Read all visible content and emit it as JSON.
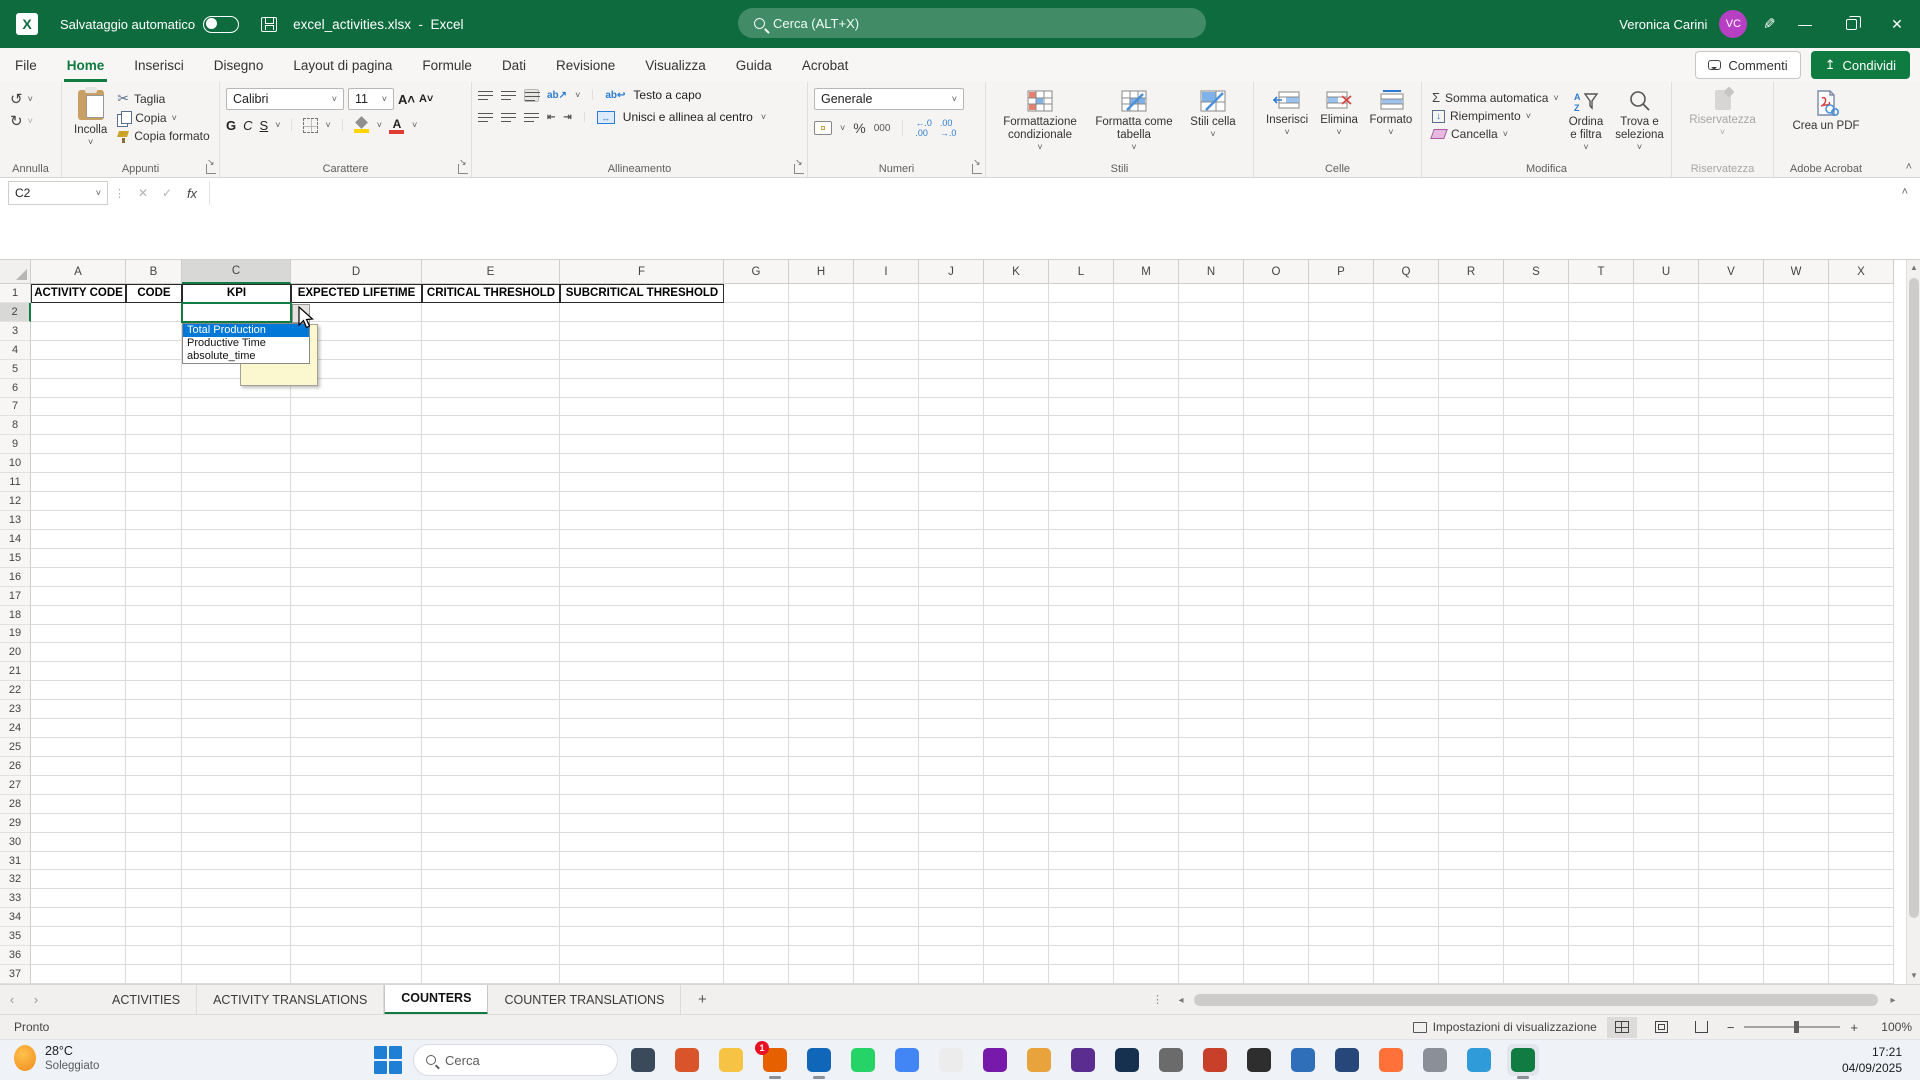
{
  "titlebar": {
    "autosave_label": "Salvataggio automatico",
    "autosave_state": "off",
    "filename": "excel_activities.xlsx",
    "separator": "-",
    "app_name": "Excel",
    "search_placeholder": "Cerca (ALT+X)",
    "user_name": "Veronica Carini",
    "user_initials": "VC"
  },
  "menubar": {
    "tabs": [
      "File",
      "Home",
      "Inserisci",
      "Disegno",
      "Layout di pagina",
      "Formule",
      "Dati",
      "Revisione",
      "Visualizza",
      "Guida",
      "Acrobat"
    ],
    "active_tab": "Home",
    "comments": "Commenti",
    "share": "Condividi"
  },
  "ribbon": {
    "annulla": {
      "label": "Annulla"
    },
    "appunti": {
      "label": "Appunti",
      "paste": "Incolla",
      "cut": "Taglia",
      "copy": "Copia",
      "format_painter": "Copia formato"
    },
    "carattere": {
      "label": "Carattere",
      "font_name": "Calibri",
      "font_size": "11",
      "bold": "G",
      "italic": "C",
      "underline": "S"
    },
    "allineamento": {
      "label": "Allineamento",
      "wrap": "Testo a capo",
      "merge": "Unisci e allinea al centro"
    },
    "numeri": {
      "label": "Numeri",
      "number_format": "Generale",
      "thousands": "000",
      "percent": "%"
    },
    "stili": {
      "label": "Stili",
      "conditional": "Formattazione condizionale",
      "format_table": "Formatta come tabella",
      "cell_styles": "Stili cella"
    },
    "celle": {
      "label": "Celle",
      "insert": "Inserisci",
      "delete": "Elimina",
      "format": "Formato"
    },
    "modifica": {
      "label": "Modifica",
      "autosum": "Somma automatica",
      "fill": "Riempimento",
      "clear": "Cancella",
      "sort": "Ordina e filtra",
      "find": "Trova e seleziona"
    },
    "riservatezza": {
      "label": "Riservatezza",
      "button": "Riservatezza"
    },
    "acrobat": {
      "label": "Adobe Acrobat",
      "create_pdf": "Crea un PDF"
    }
  },
  "formula_bar": {
    "name_box": "C2",
    "formula": ""
  },
  "grid": {
    "columns": [
      "A",
      "B",
      "C",
      "D",
      "E",
      "F",
      "G",
      "H",
      "I",
      "J",
      "K",
      "L",
      "M",
      "N",
      "O",
      "P",
      "Q",
      "R",
      "S",
      "T",
      "U",
      "V",
      "W",
      "X"
    ],
    "row_count": 37,
    "selected_cell": "C2",
    "selected_column": "C",
    "selected_row": 2,
    "table_headers": {
      "A": "ACTIVITY CODE",
      "B": "CODE",
      "C": "KPI",
      "D": "EXPECTED LIFETIME",
      "E": "CRITICAL THRESHOLD",
      "F": "SUBCRITICAL THRESHOLD"
    }
  },
  "dropdown": {
    "options": [
      "Total Production",
      "Productive Time",
      "absolute_time"
    ],
    "selected": "Total Production"
  },
  "sheet_tabs": {
    "tabs": [
      "ACTIVITIES",
      "ACTIVITY TRANSLATIONS",
      "COUNTERS",
      "COUNTER TRANSLATIONS"
    ],
    "active": "COUNTERS",
    "add": "+"
  },
  "status_bar": {
    "ready": "Pronto",
    "display_settings": "Impostazioni di visualizzazione",
    "zoom_level": "100%"
  },
  "taskbar": {
    "weather": {
      "temp": "28°C",
      "desc": "Soleggiato"
    },
    "search_placeholder": "Cerca",
    "clock": {
      "time": "17:21",
      "date": "04/09/2025"
    },
    "apps": [
      {
        "name": "task-view",
        "bg": "#3a4a5a"
      },
      {
        "name": "app-pin",
        "bg": "#d9542b"
      },
      {
        "name": "file-explorer",
        "bg": "#f6c344"
      },
      {
        "name": "browser-notifications",
        "bg": "#e66000",
        "badge": "1",
        "running": true
      },
      {
        "name": "outlook",
        "bg": "#1066b8",
        "running": true
      },
      {
        "name": "whatsapp",
        "bg": "#25d366"
      },
      {
        "name": "chrome",
        "bg": "#4285f4"
      },
      {
        "name": "chatgpt",
        "bg": "#ececec",
        "fg": "#222"
      },
      {
        "name": "onenote",
        "bg": "#7719aa"
      },
      {
        "name": "app-gold",
        "bg": "#e8a33d"
      },
      {
        "name": "visual-studio",
        "bg": "#5c2d91"
      },
      {
        "name": "mail",
        "bg": "#16314f"
      },
      {
        "name": "camera",
        "bg": "#6b6b6b"
      },
      {
        "name": "app-red",
        "bg": "#c9402a"
      },
      {
        "name": "app-dark",
        "bg": "#2e2e2e"
      },
      {
        "name": "chart-app",
        "bg": "#2f6fba"
      },
      {
        "name": "app-navy",
        "bg": "#27477a"
      },
      {
        "name": "firefox",
        "bg": "#ff7139"
      },
      {
        "name": "settings",
        "bg": "#8a8f98"
      },
      {
        "name": "photos",
        "bg": "#2f9bd8"
      },
      {
        "name": "excel",
        "bg": "#107c41",
        "running": true,
        "active": true
      }
    ]
  }
}
